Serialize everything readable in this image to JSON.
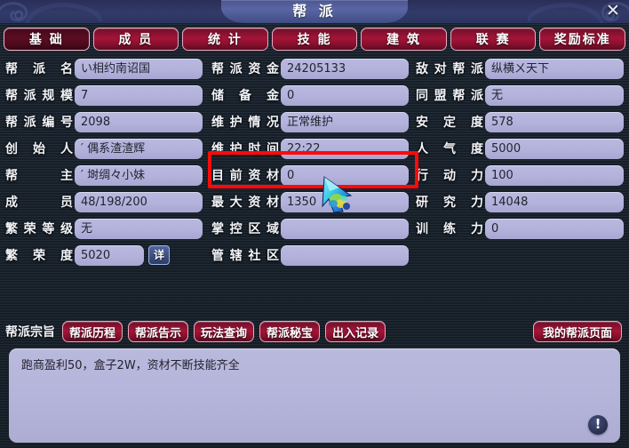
{
  "window": {
    "title": "帮 派",
    "close_label": "✕"
  },
  "tabs": [
    {
      "label": "基 础",
      "active": true
    },
    {
      "label": "成 员",
      "active": false
    },
    {
      "label": "统 计",
      "active": false
    },
    {
      "label": "技 能",
      "active": false
    },
    {
      "label": "建 筑",
      "active": false
    },
    {
      "label": "联 赛",
      "active": false
    },
    {
      "label": "奖励标准",
      "active": false
    }
  ],
  "columns": {
    "left": [
      {
        "label": "帮 派 名",
        "value": "い相约南诏国"
      },
      {
        "label": "帮派规模",
        "value": "7"
      },
      {
        "label": "帮派编号",
        "value": "2098"
      },
      {
        "label": "创 始 人",
        "value": "′ 偶系渣渣辉"
      },
      {
        "label": "帮    主",
        "value": "′ 埘绸々小妹"
      },
      {
        "label": "成    员",
        "value": "48/198/200"
      },
      {
        "label": "繁荣等级",
        "value": "无"
      },
      {
        "label": "繁 荣 度",
        "value": "5020",
        "detail_label": "详"
      }
    ],
    "middle": [
      {
        "label": "帮派资金",
        "value": "24205133"
      },
      {
        "label": "储 备 金",
        "value": "0"
      },
      {
        "label": "维护情况",
        "value": "正常维护"
      },
      {
        "label": "维护时间",
        "value": "22:22"
      },
      {
        "label": "目前资材",
        "value": "0"
      },
      {
        "label": "最大资材",
        "value": "1350"
      },
      {
        "label": "掌控区域",
        "value": ""
      },
      {
        "label": "管辖社区",
        "value": ""
      }
    ],
    "right": [
      {
        "label": "敌对帮派",
        "value": "纵横ㄨ天下"
      },
      {
        "label": "同盟帮派",
        "value": "无"
      },
      {
        "label": "安 定 度",
        "value": "578"
      },
      {
        "label": "人 气 度",
        "value": "5000"
      },
      {
        "label": "行 动 力",
        "value": "100"
      },
      {
        "label": "研 究 力",
        "value": "14048"
      },
      {
        "label": "训 练 力",
        "value": "0"
      }
    ]
  },
  "actions": {
    "label": "帮派宗旨",
    "buttons": [
      {
        "label": "帮派历程"
      },
      {
        "label": "帮派告示"
      },
      {
        "label": "玩法查询"
      },
      {
        "label": "帮派秘宝"
      },
      {
        "label": "出入记录"
      }
    ],
    "right_button": {
      "label": "我的帮派页面"
    }
  },
  "notice": {
    "text": "跑商盈利50，盒子2W，资材不断技能齐全",
    "info_label": "!"
  },
  "colors": {
    "accent_red": "#a41438",
    "highlight_red": "#ff0a0a",
    "field_bg": "#b3b2dc",
    "panel_bg": "#1a242f",
    "title_bg": "#323a68"
  }
}
